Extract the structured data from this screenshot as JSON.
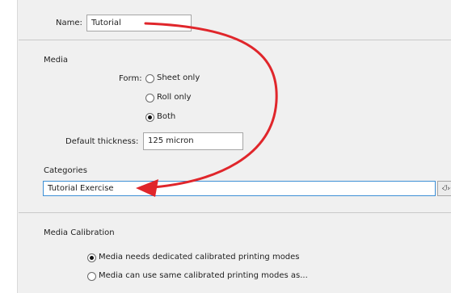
{
  "name_row": {
    "label": "Name:",
    "value": "Tutorial"
  },
  "media": {
    "heading": "Media",
    "form_label": "Form:",
    "form_options": [
      {
        "label": "Sheet only",
        "checked": false
      },
      {
        "label": "Roll only",
        "checked": false
      },
      {
        "label": "Both",
        "checked": true
      }
    ],
    "thickness_label": "Default thickness:",
    "thickness_value": "125 micron",
    "categories_label": "Categories",
    "categories_value": "Tutorial Exercise",
    "insert_button_glyph": "‹ℐ›",
    "insert_button_chevron": "▾"
  },
  "calibration": {
    "heading": "Media Calibration",
    "options": [
      {
        "label": "Media needs dedicated calibrated printing modes",
        "checked": true
      },
      {
        "label": "Media can use same calibrated printing modes as...",
        "checked": false
      }
    ]
  },
  "annotation": {
    "arrow_color": "#e0262b",
    "icon": "curved-arrow-icon"
  }
}
